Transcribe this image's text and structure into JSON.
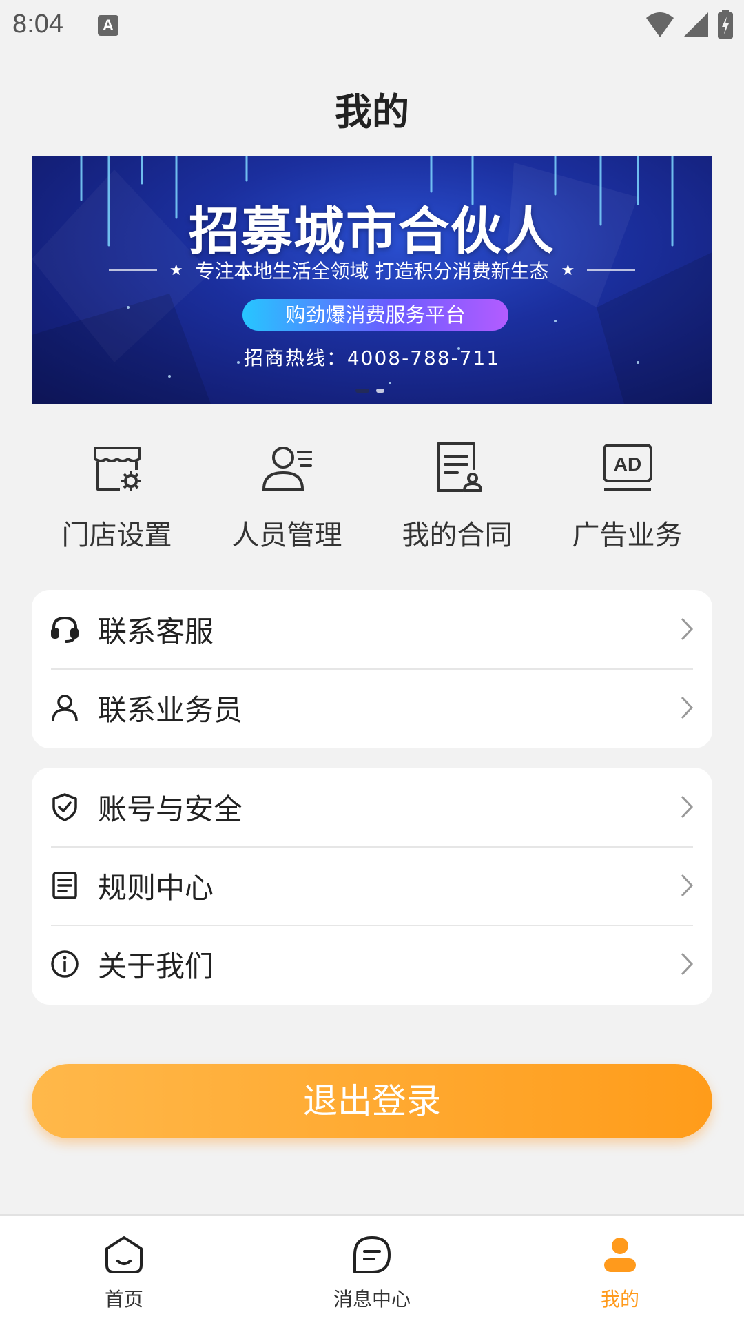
{
  "status_bar": {
    "time": "8:04",
    "notification_icon_letter": "A"
  },
  "header": {
    "title": "我的"
  },
  "banner": {
    "headline": "招募城市合伙人",
    "subtitle": "专注本地生活全领域  打造积分消费新生态",
    "pill": "购劲爆消费服务平台",
    "hotline": "招商热线：4008-788-711",
    "star": "★"
  },
  "quick_actions": [
    {
      "label": "门店设置",
      "icon": "store-settings-icon"
    },
    {
      "label": "人员管理",
      "icon": "staff-management-icon"
    },
    {
      "label": "我的合同",
      "icon": "contract-icon"
    },
    {
      "label": "广告业务",
      "icon": "ad-icon"
    }
  ],
  "menu_group_1": [
    {
      "label": "联系客服",
      "icon": "headset-icon"
    },
    {
      "label": "联系业务员",
      "icon": "person-icon"
    }
  ],
  "menu_group_2": [
    {
      "label": "账号与安全",
      "icon": "shield-icon"
    },
    {
      "label": "规则中心",
      "icon": "document-icon"
    },
    {
      "label": "关于我们",
      "icon": "info-icon"
    }
  ],
  "logout": {
    "label": "退出登录"
  },
  "bottom_nav": {
    "items": [
      {
        "label": "首页",
        "icon": "home-icon",
        "active": false
      },
      {
        "label": "消息中心",
        "icon": "message-icon",
        "active": false
      },
      {
        "label": "我的",
        "icon": "profile-icon",
        "active": true
      }
    ],
    "active_color": "#ff9a1c"
  },
  "colors": {
    "accent": "#ff9a1c",
    "banner_bg": "#1b2f9e",
    "background": "#f2f2f2"
  }
}
